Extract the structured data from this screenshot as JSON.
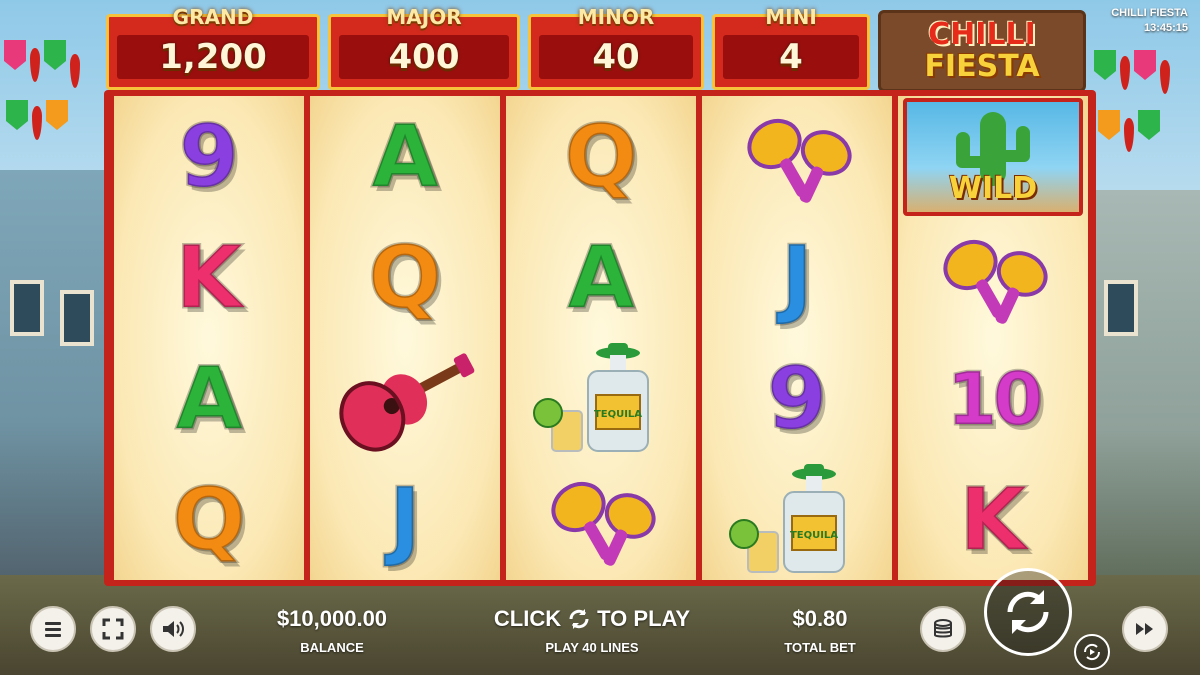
{
  "game": {
    "title": "CHILLI FIESTA",
    "clock": "13:45:15",
    "logo_line1": "CHILLI",
    "logo_line2": "FIESTA"
  },
  "jackpots": [
    {
      "label": "GRAND",
      "value": "1,200"
    },
    {
      "label": "MAJOR",
      "value": "400"
    },
    {
      "label": "MINOR",
      "value": "40"
    },
    {
      "label": "MINI",
      "value": "4"
    }
  ],
  "reels": [
    [
      "9",
      "K",
      "A",
      "Q"
    ],
    [
      "A",
      "Q",
      "guitar",
      "J"
    ],
    [
      "Q",
      "A",
      "tequila",
      "maracas"
    ],
    [
      "maracas",
      "J",
      "9",
      "tequila"
    ],
    [
      "wild",
      "maracas",
      "10",
      "K"
    ]
  ],
  "wild_label": "WILD",
  "tequila_label": "TEQUILA",
  "bottom_bar": {
    "balance_value": "$10,000.00",
    "balance_label": "BALANCE",
    "play_prompt_left": "CLICK",
    "play_prompt_right": "TO PLAY",
    "lines_label": "PLAY 40 LINES",
    "bet_value": "$0.80",
    "bet_label": "TOTAL BET"
  },
  "icons": {
    "menu": "menu-icon",
    "fullscreen": "fullscreen-icon",
    "sound": "speaker-icon",
    "coins": "coin-stack-icon",
    "spin": "spin-arrows-icon",
    "autoplay": "autoplay-icon",
    "turbo": "fast-forward-icon"
  },
  "colors": {
    "jackpot_red": "#d42a1e",
    "jackpot_border": "#f7c33a",
    "reel_bg": "#fbe8b4"
  }
}
